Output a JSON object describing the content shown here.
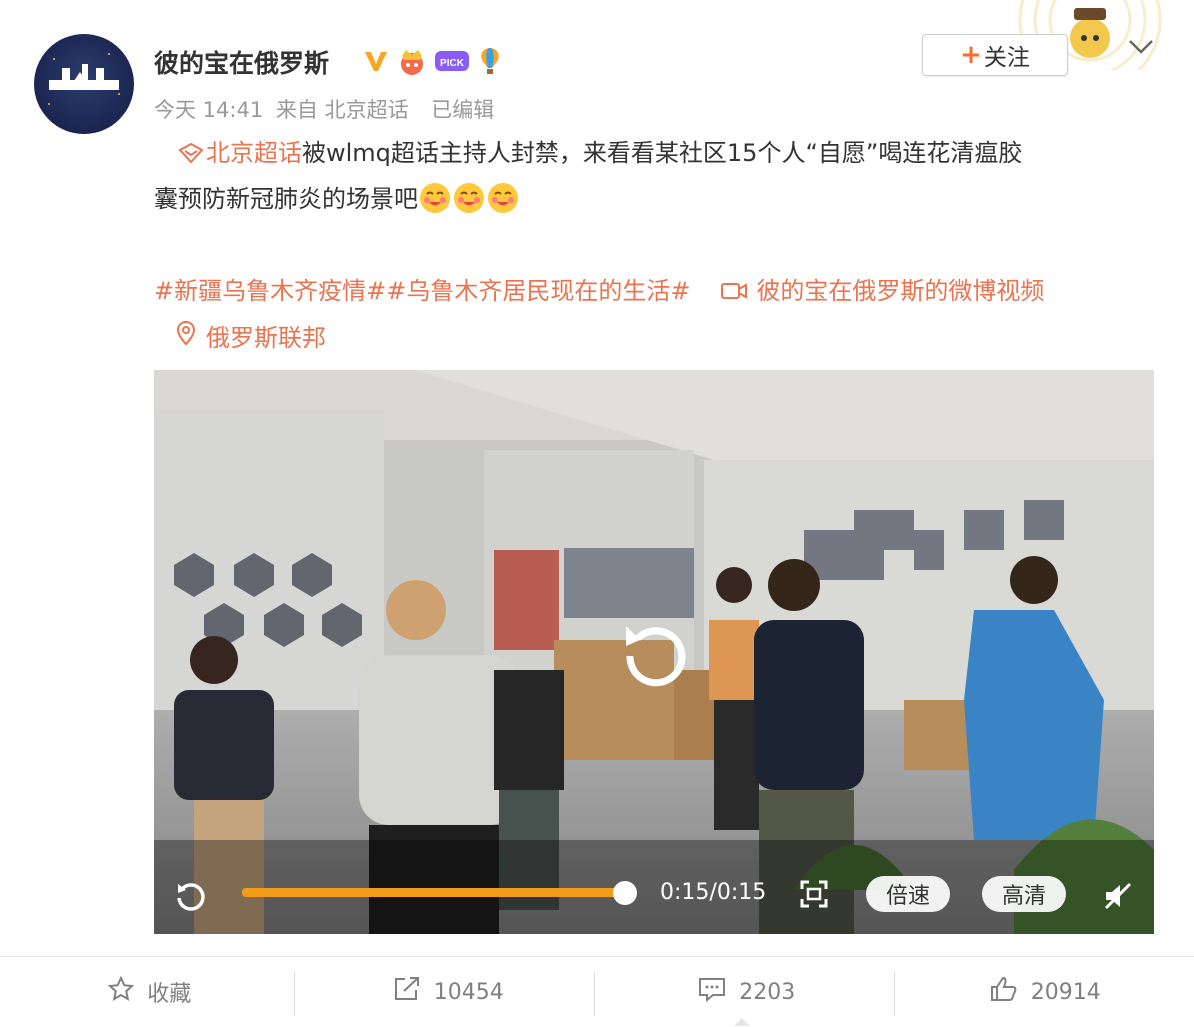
{
  "post": {
    "username": "彼的宝在俄罗斯",
    "time": "今天 14:41",
    "source": "来自 北京超话",
    "edited": "已编辑",
    "follow_label": "关注",
    "supertopic_link": "北京超话",
    "body_line1": "被wlmq超话主持人封禁，来看看某社区15个人“自愿”喝连花清瘟胶",
    "body_line2": "囊预防新冠肺炎的场景吧",
    "hashtag1": "#新疆乌鲁木齐疫情#",
    "hashtag2": "#乌鲁木齐居民现在的生活#",
    "video_link": "彼的宝在俄罗斯的微博视频",
    "location": "俄罗斯联邦"
  },
  "badges": [
    "vip-v-badge",
    "crown-badge",
    "pick-badge",
    "balloon-badge"
  ],
  "pick_badge_text": "PICK",
  "video": {
    "time": "0:15/0:15",
    "progress": 1.0,
    "speed_label": "倍速",
    "quality_label": "高清"
  },
  "actions": {
    "favorite_label": "收藏",
    "repost_count": "10454",
    "comment_count": "2203",
    "like_count": "20914"
  },
  "colors": {
    "accent": "#eb7350",
    "progress": "#f39c1a",
    "vip": "#f5a623"
  }
}
